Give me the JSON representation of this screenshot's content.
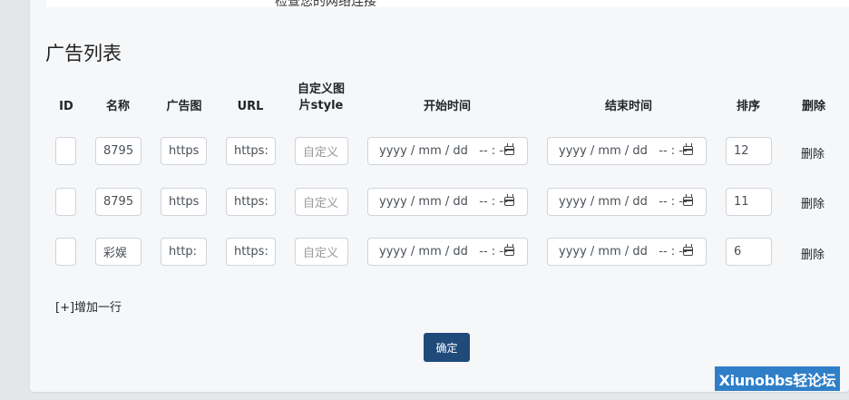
{
  "top_notice": "检查您的网络连接",
  "title": "广告列表",
  "columns": {
    "id": "ID",
    "name": "名称",
    "ad_image": "广告图",
    "url": "URL",
    "custom_style_line1": "自定义图",
    "custom_style_line2": "片style",
    "start_time": "开始时间",
    "end_time": "结束时间",
    "order": "排序",
    "delete": "删除"
  },
  "rows": [
    {
      "id": "",
      "name": "8795",
      "image": "https",
      "url": "https:",
      "style_placeholder": "自定义",
      "start": "yyyy / mm / dd   -- : --",
      "end": "yyyy / mm / dd   -- : --",
      "order": "12",
      "delete": "删除"
    },
    {
      "id": "",
      "name": "8795",
      "image": "https",
      "url": "https:",
      "style_placeholder": "自定义",
      "start": "yyyy / mm / dd   -- : --",
      "end": "yyyy / mm / dd   -- : --",
      "order": "11",
      "delete": "删除"
    },
    {
      "id": "",
      "name": "彩娱",
      "image": "http:",
      "url": "https:",
      "style_placeholder": "自定义",
      "start": "yyyy / mm / dd   -- : --",
      "end": "yyyy / mm / dd   -- : --",
      "order": "6",
      "delete": "删除"
    }
  ],
  "add_row": "[+]增加一行",
  "confirm": "确定",
  "watermark": "Xiunobbs轻论坛",
  "icons": {
    "date": "calendar-icon"
  },
  "colors": {
    "primary_button": "#1f4a7a",
    "watermark_bg": "#2f7fc8"
  }
}
